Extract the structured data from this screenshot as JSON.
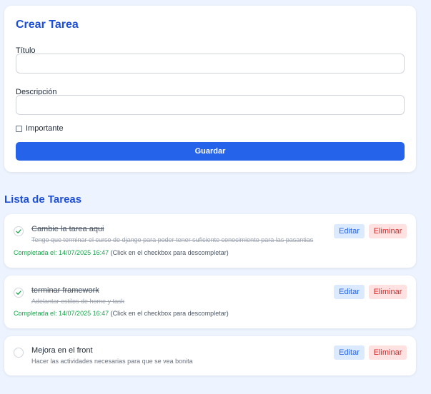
{
  "form": {
    "title": "Crear Tarea",
    "title_label": "Título",
    "title_value": "",
    "description_label": "Descripción",
    "description_value": "",
    "important_label": "Importante",
    "save_label": "Guardar"
  },
  "list": {
    "title": "Lista de Tareas",
    "edit_label": "Editar",
    "delete_label": "Eliminar",
    "tasks": [
      {
        "title": "Cambie la tarea aqui",
        "description": "Tengo que terminar el curso de django para poder tener suficiente conocimiento para las pasantias",
        "completed": true,
        "completed_label": "Completada el: 14/07/2025 16:47",
        "completed_hint": "(Click en el checkbox para descompletar)"
      },
      {
        "title": "terminar framework",
        "description": "Adelantar estilos de home y task",
        "completed": true,
        "completed_label": "Completada el: 14/07/2025 16:47",
        "completed_hint": "(Click en el checkbox para descompletar)"
      },
      {
        "title": "Mejora en el front",
        "description": "Hacer las actividades necesarias para que se vea bonita",
        "completed": false
      }
    ]
  },
  "colors": {
    "accent": "#2563eb",
    "heading": "#1d4ed8",
    "completed": "#16a34a",
    "danger": "#dc2626"
  },
  "icons": {
    "checked": "check-icon",
    "unchecked": "empty-circle-icon"
  }
}
